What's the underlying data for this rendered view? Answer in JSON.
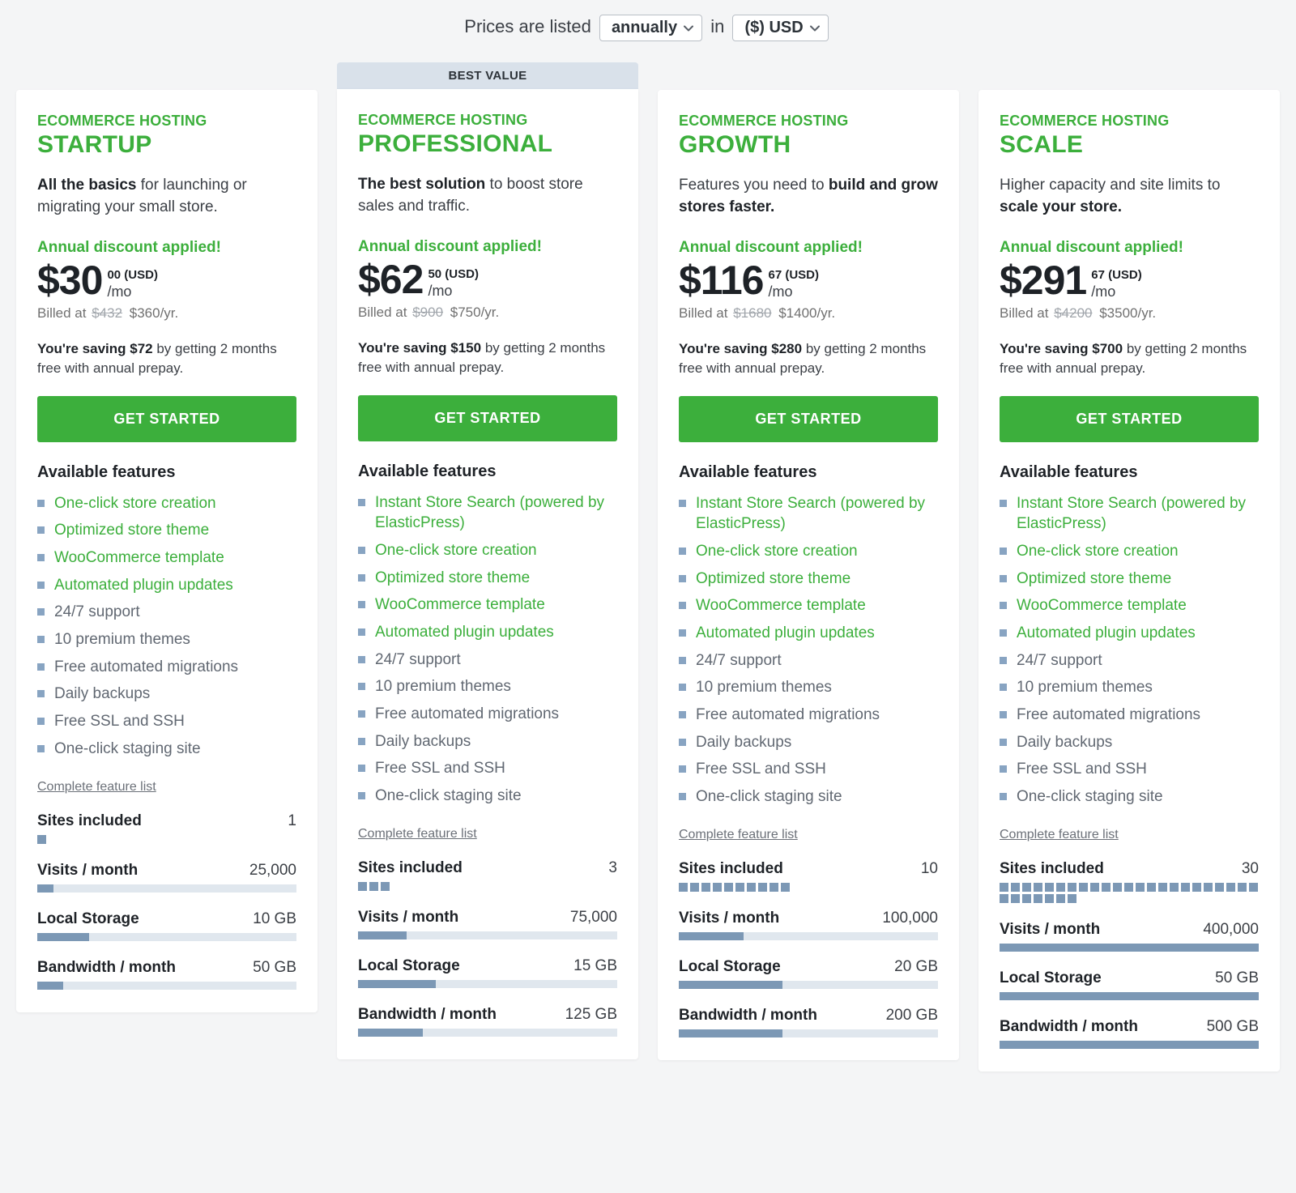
{
  "header": {
    "prefix": "Prices are listed",
    "between": "in",
    "period": "annually",
    "currency": "($) USD"
  },
  "labels": {
    "eyebrow": "ECOMMERCE HOSTING",
    "discount": "Annual discount applied!",
    "per": "/mo",
    "billed_prefix": "Billed at",
    "saving_tail": "by getting 2 months free with annual prepay.",
    "cta": "GET STARTED",
    "features_title": "Available features",
    "complete": "Complete feature list",
    "badge": "BEST VALUE",
    "metrics": {
      "sites": "Sites included",
      "visits": "Visits / month",
      "storage": "Local Storage",
      "bandwidth": "Bandwidth / month"
    }
  },
  "max": {
    "sites": 30,
    "visits": 400000,
    "storage": 50,
    "bandwidth": 500
  },
  "plans": [
    {
      "name": "STARTUP",
      "badge": false,
      "tagline_bold": "All the basics",
      "tagline_rest": " for launching or migrating your small store.",
      "price": "$30",
      "cents_cur": "00 (USD)",
      "strike": "$432",
      "annual": "$360/yr.",
      "saving_bold": "You're saving $72",
      "features": [
        {
          "t": "One-click store creation",
          "h": true
        },
        {
          "t": "Optimized store theme",
          "h": true
        },
        {
          "t": "WooCommerce template",
          "h": true
        },
        {
          "t": "Automated plugin updates",
          "h": true
        },
        {
          "t": "24/7 support",
          "h": false
        },
        {
          "t": "10 premium themes",
          "h": false
        },
        {
          "t": "Free automated migrations",
          "h": false
        },
        {
          "t": "Daily backups",
          "h": false
        },
        {
          "t": "Free SSL and SSH",
          "h": false
        },
        {
          "t": "One-click staging site",
          "h": false
        }
      ],
      "metrics": {
        "sites": 1,
        "visits": "25,000",
        "visits_n": 25000,
        "storage": "10 GB",
        "storage_n": 10,
        "bandwidth": "50 GB",
        "bandwidth_n": 50
      }
    },
    {
      "name": "PROFESSIONAL",
      "badge": true,
      "tagline_bold": "The best solution",
      "tagline_rest": " to boost store sales and traffic.",
      "price": "$62",
      "cents_cur": "50 (USD)",
      "strike": "$900",
      "annual": "$750/yr.",
      "saving_bold": "You're saving $150",
      "features": [
        {
          "t": "Instant Store Search (powered by ElasticPress)",
          "h": true
        },
        {
          "t": "One-click store creation",
          "h": true
        },
        {
          "t": "Optimized store theme",
          "h": true
        },
        {
          "t": "WooCommerce template",
          "h": true
        },
        {
          "t": "Automated plugin updates",
          "h": true
        },
        {
          "t": "24/7 support",
          "h": false
        },
        {
          "t": "10 premium themes",
          "h": false
        },
        {
          "t": "Free automated migrations",
          "h": false
        },
        {
          "t": "Daily backups",
          "h": false
        },
        {
          "t": "Free SSL and SSH",
          "h": false
        },
        {
          "t": "One-click staging site",
          "h": false
        }
      ],
      "metrics": {
        "sites": 3,
        "visits": "75,000",
        "visits_n": 75000,
        "storage": "15 GB",
        "storage_n": 15,
        "bandwidth": "125 GB",
        "bandwidth_n": 125
      }
    },
    {
      "name": "GROWTH",
      "badge": false,
      "tagline_pre": "Features you need to ",
      "tagline_bold": "build and grow stores faster.",
      "tagline_rest": "",
      "price": "$116",
      "cents_cur": "67 (USD)",
      "strike": "$1680",
      "annual": "$1400/yr.",
      "saving_bold": "You're saving $280",
      "features": [
        {
          "t": "Instant Store Search (powered by ElasticPress)",
          "h": true
        },
        {
          "t": "One-click store creation",
          "h": true
        },
        {
          "t": "Optimized store theme",
          "h": true
        },
        {
          "t": "WooCommerce template",
          "h": true
        },
        {
          "t": "Automated plugin updates",
          "h": true
        },
        {
          "t": "24/7 support",
          "h": false
        },
        {
          "t": "10 premium themes",
          "h": false
        },
        {
          "t": "Free automated migrations",
          "h": false
        },
        {
          "t": "Daily backups",
          "h": false
        },
        {
          "t": "Free SSL and SSH",
          "h": false
        },
        {
          "t": "One-click staging site",
          "h": false
        }
      ],
      "metrics": {
        "sites": 10,
        "visits": "100,000",
        "visits_n": 100000,
        "storage": "20 GB",
        "storage_n": 20,
        "bandwidth": "200 GB",
        "bandwidth_n": 200
      }
    },
    {
      "name": "SCALE",
      "badge": false,
      "tagline_pre": "Higher capacity and site limits to ",
      "tagline_bold": "scale your store.",
      "tagline_rest": "",
      "price": "$291",
      "cents_cur": "67 (USD)",
      "strike": "$4200",
      "annual": "$3500/yr.",
      "saving_bold": "You're saving $700",
      "features": [
        {
          "t": "Instant Store Search (powered by ElasticPress)",
          "h": true
        },
        {
          "t": "One-click store creation",
          "h": true
        },
        {
          "t": "Optimized store theme",
          "h": true
        },
        {
          "t": "WooCommerce template",
          "h": true
        },
        {
          "t": "Automated plugin updates",
          "h": true
        },
        {
          "t": "24/7 support",
          "h": false
        },
        {
          "t": "10 premium themes",
          "h": false
        },
        {
          "t": "Free automated migrations",
          "h": false
        },
        {
          "t": "Daily backups",
          "h": false
        },
        {
          "t": "Free SSL and SSH",
          "h": false
        },
        {
          "t": "One-click staging site",
          "h": false
        }
      ],
      "metrics": {
        "sites": 30,
        "visits": "400,000",
        "visits_n": 400000,
        "storage": "50 GB",
        "storage_n": 50,
        "bandwidth": "500 GB",
        "bandwidth_n": 500
      }
    }
  ]
}
